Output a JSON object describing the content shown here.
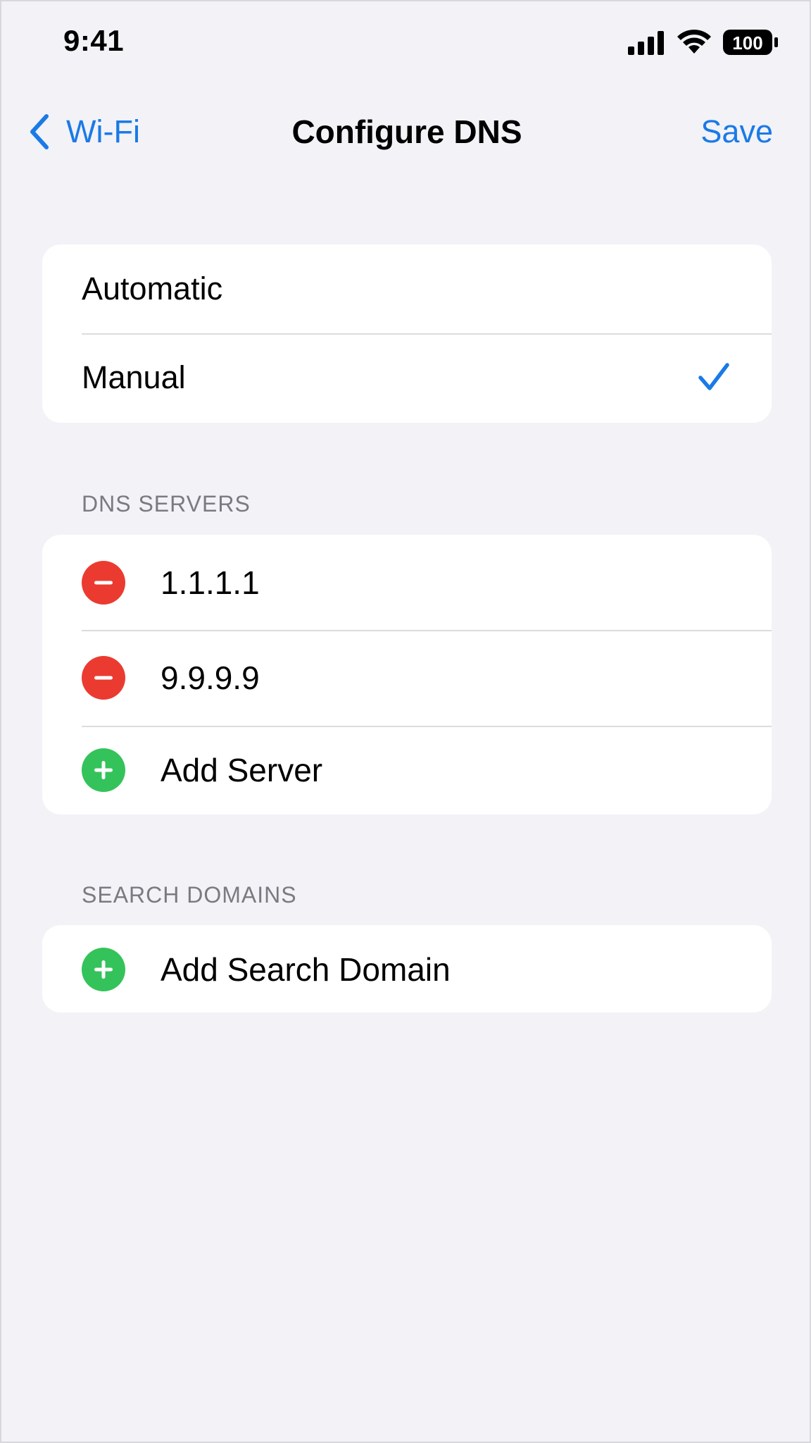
{
  "status_bar": {
    "time": "9:41",
    "battery_level": "100",
    "icons": [
      "cellular-signal-icon",
      "wifi-icon",
      "battery-icon"
    ]
  },
  "nav": {
    "back_label": "Wi-Fi",
    "title": "Configure DNS",
    "save_label": "Save"
  },
  "mode": {
    "options": [
      {
        "label": "Automatic",
        "selected": false
      },
      {
        "label": "Manual",
        "selected": true
      }
    ]
  },
  "dns_servers": {
    "header": "DNS SERVERS",
    "servers": [
      "1.1.1.1",
      "9.9.9.9"
    ],
    "add_label": "Add Server"
  },
  "search_domains": {
    "header": "SEARCH DOMAINS",
    "add_label": "Add Search Domain"
  },
  "colors": {
    "accent": "#1a7ae6",
    "remove": "#eb3b30",
    "add": "#34c35a",
    "background": "#f2f2f7"
  }
}
